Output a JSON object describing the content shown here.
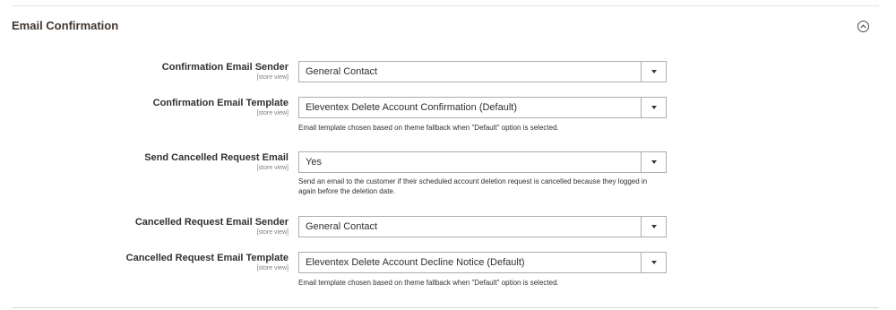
{
  "section": {
    "title": "Email Confirmation"
  },
  "fields": [
    {
      "label": "Confirmation Email Sender",
      "scope": "[store view]",
      "value": "General Contact",
      "note": ""
    },
    {
      "label": "Confirmation Email Template",
      "scope": "[store view]",
      "value": "Eleventex Delete Account Confirmation (Default)",
      "note": "Email template chosen based on theme fallback when \"Default\" option is selected."
    },
    {
      "label": "Send Cancelled Request Email",
      "scope": "[store view]",
      "value": "Yes",
      "note": "Send an email to the customer if their scheduled account deletion request is cancelled because they logged in again before the deletion date."
    },
    {
      "label": "Cancelled Request Email Sender",
      "scope": "[store view]",
      "value": "General Contact",
      "note": ""
    },
    {
      "label": "Cancelled Request Email Template",
      "scope": "[store view]",
      "value": "Eleventex Delete Account Decline Notice (Default)",
      "note": "Email template chosen based on theme fallback when \"Default\" option is selected."
    }
  ]
}
